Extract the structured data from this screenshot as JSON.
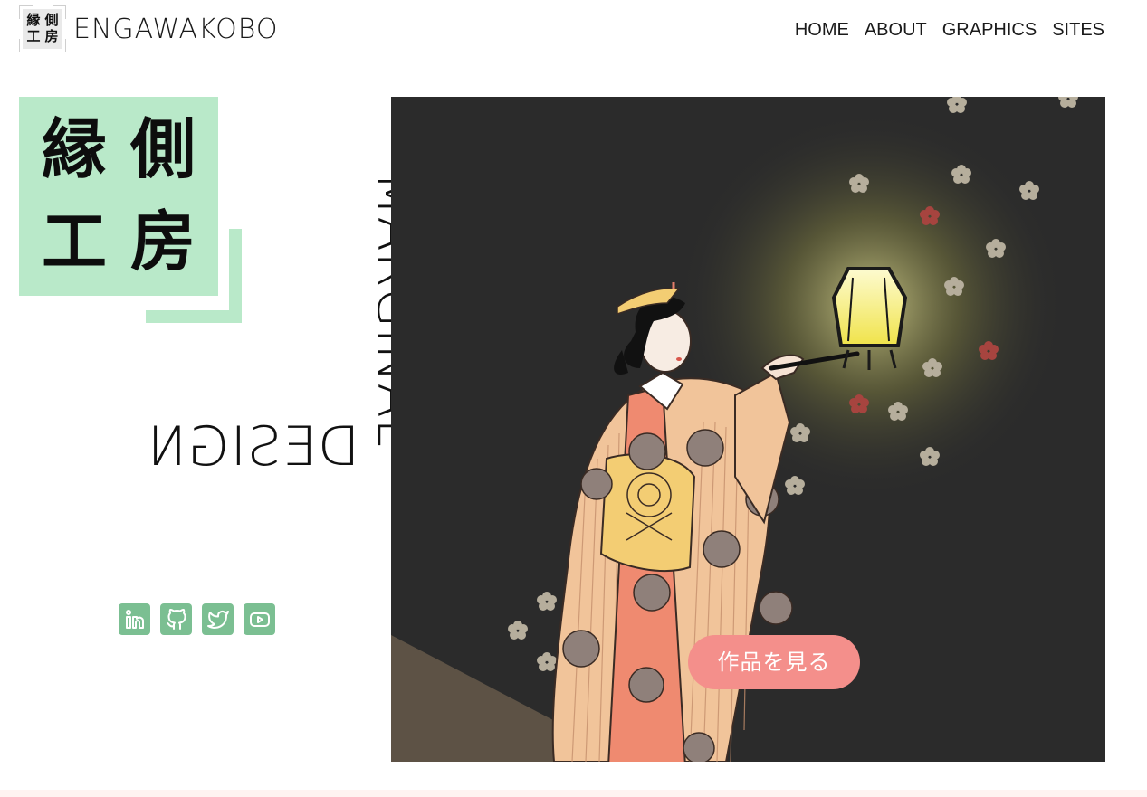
{
  "header": {
    "logo_chars": [
      "縁",
      "側",
      "工",
      "房"
    ],
    "brand": "ENGAWAKOBO",
    "nav": [
      "HOME",
      "ABOUT",
      "GRAPHICS",
      "SITES"
    ]
  },
  "hero": {
    "kanji": [
      "縁",
      "側",
      "工",
      "房"
    ],
    "vertical_word": "MARGINAL",
    "mirrored_word": "DESIGN",
    "cta_label": "作品を見る",
    "art_subject": "ukiyo-e woman in kimono holding a glowing lantern among plum blossoms"
  },
  "socials": [
    {
      "icon": "linkedin-icon"
    },
    {
      "icon": "github-icon"
    },
    {
      "icon": "twitter-icon"
    },
    {
      "icon": "youtube-icon"
    }
  ],
  "colors": {
    "accent_green": "#b9e9c9",
    "social_green": "#7bbf92",
    "cta_pink": "#f48f8b",
    "art_background": "#2b2b2b",
    "footer_tint": "#fff3f1"
  }
}
